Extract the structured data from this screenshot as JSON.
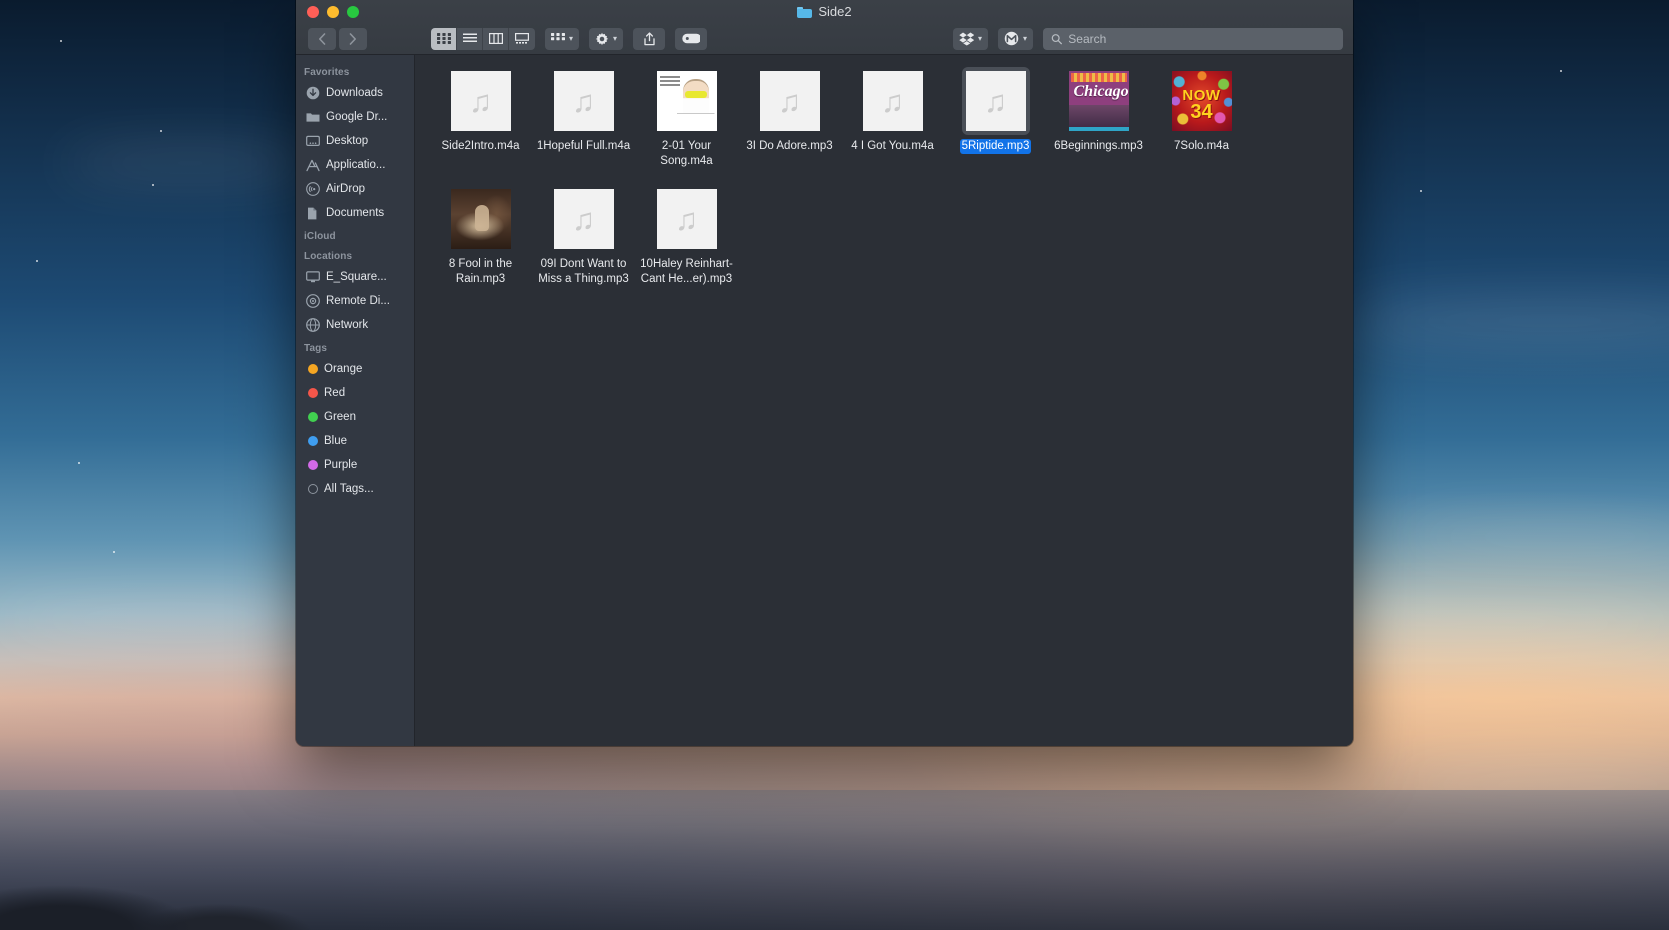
{
  "window": {
    "title": "Side2",
    "title_icon": "blue-folder-icon"
  },
  "traffic_lights": [
    {
      "name": "close-button",
      "color": "#ff5f57"
    },
    {
      "name": "minimize-button",
      "color": "#febc2e"
    },
    {
      "name": "maximize-button",
      "color": "#28c840"
    }
  ],
  "toolbar": {
    "back_label": "‹",
    "forward_label": "›",
    "view_buttons": [
      {
        "name": "icon-view",
        "icon": "grid-icon",
        "active": true
      },
      {
        "name": "list-view",
        "icon": "list-icon",
        "active": false
      },
      {
        "name": "column-view",
        "icon": "columns-icon",
        "active": false
      },
      {
        "name": "gallery-view",
        "icon": "gallery-icon",
        "active": false
      }
    ],
    "group_by_icon": "grid-group-icon",
    "action_icon": "gear-icon",
    "share_icon": "share-icon",
    "tag_icon": "tag-icon",
    "dropbox_icon": "dropbox-icon",
    "mega_icon": "mega-circle-icon"
  },
  "search": {
    "placeholder": "Search",
    "value": "",
    "icon": "search-icon"
  },
  "sidebar": {
    "sections": [
      {
        "header": "Favorites",
        "items": [
          {
            "label": "Downloads",
            "icon": "download-circle-icon"
          },
          {
            "label": "Google Dr...",
            "icon": "folder-icon"
          },
          {
            "label": "Desktop",
            "icon": "desktop-icon"
          },
          {
            "label": "Applicatio...",
            "icon": "applications-icon"
          },
          {
            "label": "AirDrop",
            "icon": "airdrop-icon"
          },
          {
            "label": "Documents",
            "icon": "documents-icon"
          }
        ]
      },
      {
        "header": "iCloud",
        "items": []
      },
      {
        "header": "Locations",
        "items": [
          {
            "label": "E_Square...",
            "icon": "display-icon"
          },
          {
            "label": "Remote Di...",
            "icon": "disc-icon"
          },
          {
            "label": "Network",
            "icon": "globe-icon"
          }
        ]
      },
      {
        "header": "Tags",
        "items": [
          {
            "label": "Orange",
            "icon": "tag-dot-icon",
            "color": "#f5a623"
          },
          {
            "label": "Red",
            "icon": "tag-dot-icon",
            "color": "#f4564a"
          },
          {
            "label": "Green",
            "icon": "tag-dot-icon",
            "color": "#41d050"
          },
          {
            "label": "Blue",
            "icon": "tag-dot-icon",
            "color": "#3f9ef0"
          },
          {
            "label": "Purple",
            "icon": "tag-dot-icon",
            "color": "#d36ae8"
          },
          {
            "label": "All Tags...",
            "icon": "tag-dot-hollow-icon",
            "color": ""
          }
        ]
      }
    ]
  },
  "files": [
    {
      "name": "Side2Intro.m4a",
      "thumb": "music-note",
      "selected": false
    },
    {
      "name": "1Hopeful Full.m4a",
      "thumb": "music-note",
      "selected": false
    },
    {
      "name": "2-01 Your Song.m4a",
      "thumb": "art-elton",
      "selected": false
    },
    {
      "name": "3I Do Adore.mp3",
      "thumb": "music-note",
      "selected": false
    },
    {
      "name": "4 I Got You.m4a",
      "thumb": "music-note",
      "selected": false
    },
    {
      "name": "5Riptide.mp3",
      "thumb": "music-note",
      "selected": true
    },
    {
      "name": "6Beginnings.mp3",
      "thumb": "art-chicago",
      "selected": false
    },
    {
      "name": "7Solo.m4a",
      "thumb": "art-now",
      "selected": false
    },
    {
      "name": "8 Fool in the Rain.mp3",
      "thumb": "art-fool",
      "selected": false
    },
    {
      "name": "09I Dont Want to Miss a Thing.mp3",
      "thumb": "music-note",
      "selected": false
    },
    {
      "name": "10Haley Reinhart-Cant He...er).mp3",
      "thumb": "music-note",
      "selected": false
    }
  ],
  "colors": {
    "selection_blue": "#1273e8",
    "window_bg": "#2b2f36",
    "sidebar_bg": "#323842",
    "titlebar_bg": "#3b4047"
  },
  "album_art": {
    "elton": {
      "line_text": "ELTON JOHN GREATEST HITS 1970-2002"
    },
    "chicago": {
      "logo": "Chicago"
    },
    "now": {
      "title": "NOW",
      "number": "34"
    }
  }
}
